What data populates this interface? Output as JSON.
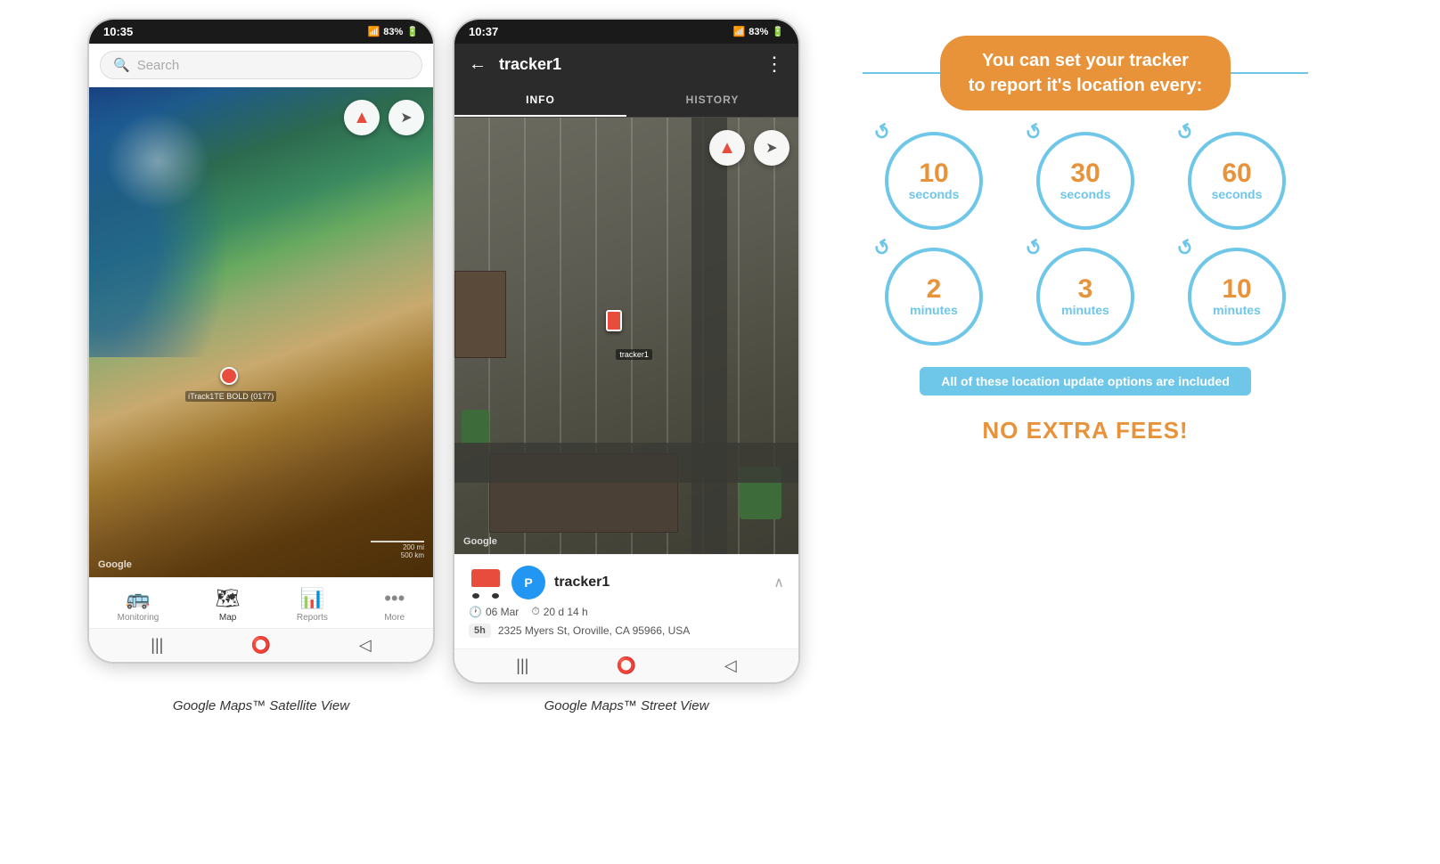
{
  "phone1": {
    "status": {
      "time": "10:35",
      "signal": "📶",
      "battery": "83%"
    },
    "search": {
      "placeholder": "Search"
    },
    "map": {
      "tracker_label": "iTrack1TE BOLD (0177)",
      "google_label": "Google",
      "scale_top": "200 mi",
      "scale_bottom": "500 km"
    },
    "nav": [
      {
        "icon": "🚌",
        "label": "Monitoring",
        "active": false
      },
      {
        "icon": "🗺",
        "label": "Map",
        "active": true
      },
      {
        "icon": "📊",
        "label": "Reports",
        "active": false
      },
      {
        "icon": "•••",
        "label": "More",
        "active": false
      }
    ],
    "caption": "Google Maps™ Satellite View"
  },
  "phone2": {
    "status": {
      "time": "10:37",
      "battery": "83%"
    },
    "header": {
      "title": "tracker1",
      "back_icon": "←",
      "menu_icon": "⋮"
    },
    "tabs": [
      {
        "label": "INFO",
        "active": true
      },
      {
        "label": "HISTORY",
        "active": false
      }
    ],
    "map": {
      "tracker_label": "tracker1",
      "google_label": "Google"
    },
    "tracker_card": {
      "name": "tracker1",
      "avatar_letter": "P",
      "date": "06 Mar",
      "duration": "20 d 14 h",
      "time_badge": "5h",
      "address": "2325 Myers St, Oroville, CA 95966, USA"
    },
    "caption": "Google Maps™ Street View"
  },
  "info_panel": {
    "title_line1": "You can set your tracker",
    "title_line2": "to report it's location every:",
    "circles": [
      {
        "number": "10",
        "unit": "seconds"
      },
      {
        "number": "30",
        "unit": "seconds"
      },
      {
        "number": "60",
        "unit": "seconds"
      },
      {
        "number": "2",
        "unit": "minutes"
      },
      {
        "number": "3",
        "unit": "minutes"
      },
      {
        "number": "10",
        "unit": "minutes"
      }
    ],
    "included_text": "All of these location update options are included",
    "no_fees_text": "NO EXTRA FEES!"
  }
}
